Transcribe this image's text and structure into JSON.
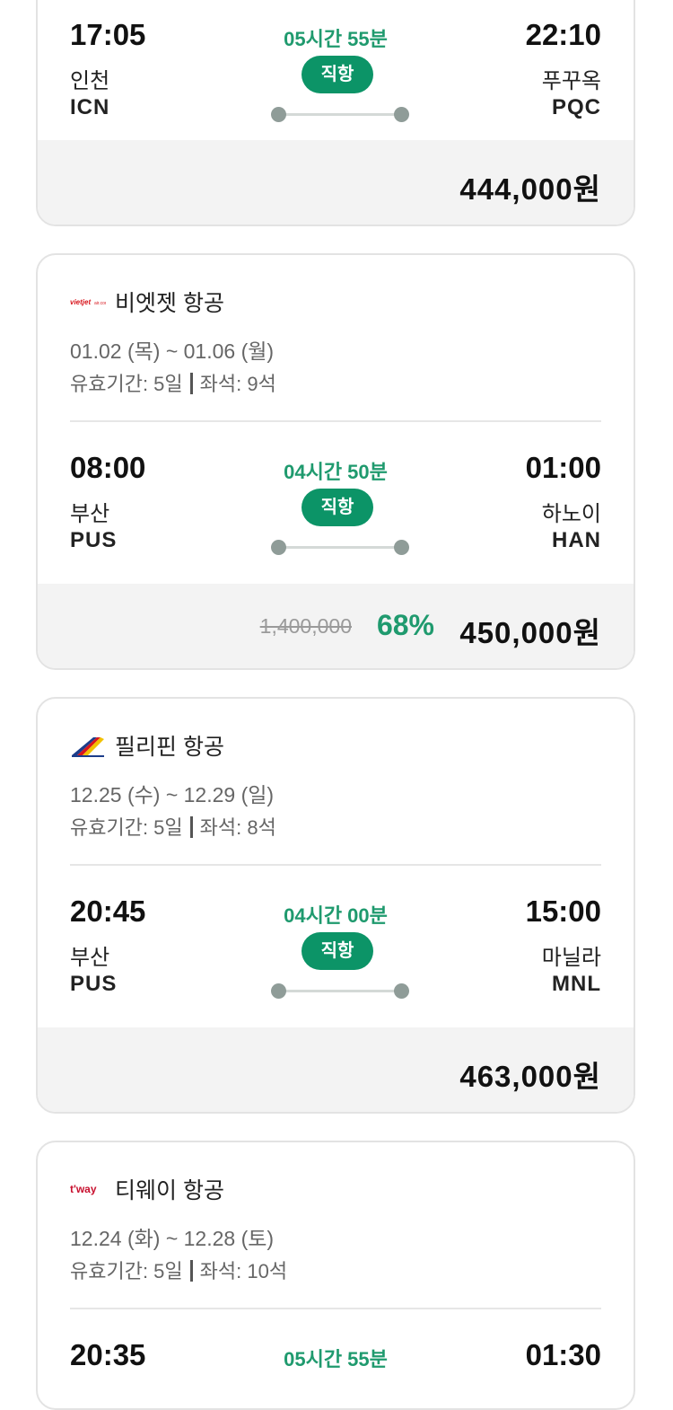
{
  "flights": [
    {
      "airline": "",
      "dates": "",
      "validity": "",
      "seats": "",
      "dep_time": "17:05",
      "dep_city": "인천",
      "dep_code": "ICN",
      "duration": "05시간 55분",
      "type": "직항",
      "arr_time": "22:10",
      "arr_city": "푸꾸옥",
      "arr_code": "PQC",
      "original_price": "",
      "discount": "",
      "price": "444,000원"
    },
    {
      "airline": "비엣젯 항공",
      "logo": "vietjet-logo",
      "dates": "01.02 (목) ~ 01.06 (월)",
      "validity": "유효기간: 5일",
      "seats": "좌석: 9석",
      "dep_time": "08:00",
      "dep_city": "부산",
      "dep_code": "PUS",
      "duration": "04시간 50분",
      "type": "직항",
      "arr_time": "01:00",
      "arr_city": "하노이",
      "arr_code": "HAN",
      "original_price": "1,400,000",
      "discount": "68%",
      "price": "450,000원"
    },
    {
      "airline": "필리핀 항공",
      "logo": "philippine-airlines-logo",
      "dates": "12.25 (수) ~ 12.29 (일)",
      "validity": "유효기간: 5일",
      "seats": "좌석: 8석",
      "dep_time": "20:45",
      "dep_city": "부산",
      "dep_code": "PUS",
      "duration": "04시간 00분",
      "type": "직항",
      "arr_time": "15:00",
      "arr_city": "마닐라",
      "arr_code": "MNL",
      "original_price": "",
      "discount": "",
      "price": "463,000원"
    },
    {
      "airline": "티웨이 항공",
      "logo": "tway-logo",
      "dates": "12.24 (화) ~ 12.28 (토)",
      "validity": "유효기간: 5일",
      "seats": "좌석: 10석",
      "dep_time": "20:35",
      "duration": "05시간 55분",
      "arr_time": "01:30"
    }
  ],
  "colors": {
    "accent": "#1f9a6e",
    "badge": "#0c9467",
    "price_bar": "#f3f3f3"
  }
}
